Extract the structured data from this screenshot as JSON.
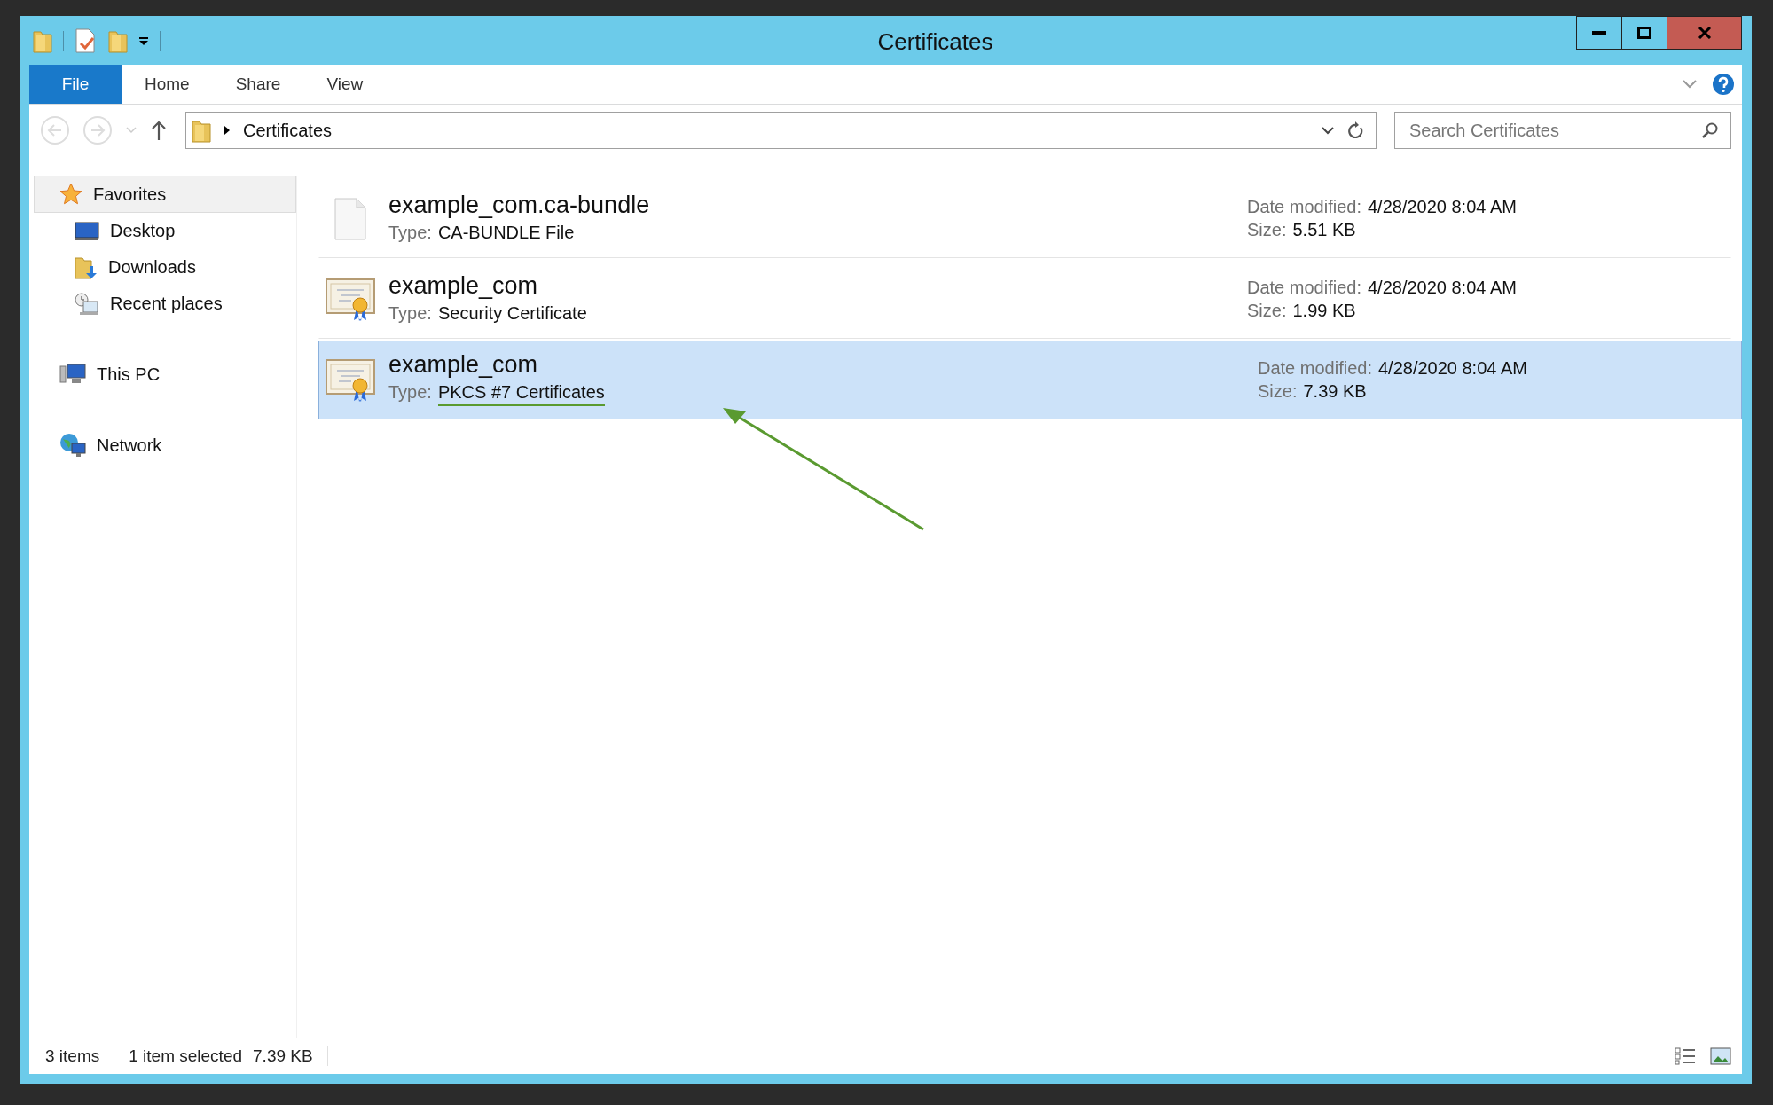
{
  "window": {
    "title": "Certificates"
  },
  "ribbon": {
    "tabs": [
      {
        "label": "File",
        "selected": true
      },
      {
        "label": "Home",
        "selected": false
      },
      {
        "label": "Share",
        "selected": false
      },
      {
        "label": "View",
        "selected": false
      }
    ]
  },
  "address_bar": {
    "path": "Certificates"
  },
  "search": {
    "placeholder": "Search Certificates"
  },
  "sidebar": {
    "items": [
      {
        "label": "Favorites",
        "selected": true,
        "children": [
          {
            "label": "Desktop",
            "selected": false
          },
          {
            "label": "Downloads",
            "selected": false
          },
          {
            "label": "Recent places",
            "selected": false
          }
        ]
      },
      {
        "label": "This PC",
        "selected": false
      },
      {
        "label": "Network",
        "selected": false
      }
    ]
  },
  "files": [
    {
      "kind": "blank",
      "name": "example_com.ca-bundle",
      "type_label": "Type:",
      "type": "CA-BUNDLE File",
      "type_underlined": false,
      "date_label": "Date modified:",
      "date": "4/28/2020 8:04 AM",
      "size_label": "Size:",
      "size": "5.51 KB",
      "selected": false
    },
    {
      "kind": "certificate",
      "name": "example_com",
      "type_label": "Type:",
      "type": "Security Certificate",
      "type_underlined": false,
      "date_label": "Date modified:",
      "date": "4/28/2020 8:04 AM",
      "size_label": "Size:",
      "size": "1.99 KB",
      "selected": false
    },
    {
      "kind": "certificate",
      "name": "example_com",
      "type_label": "Type:",
      "type": "PKCS #7 Certificates",
      "type_underlined": true,
      "date_label": "Date modified:",
      "date": "4/28/2020 8:04 AM",
      "size_label": "Size:",
      "size": "7.39 KB",
      "selected": true
    }
  ],
  "status_bar": {
    "item_count": "3 items",
    "selection": "1 item selected",
    "selection_size": "7.39 KB"
  }
}
